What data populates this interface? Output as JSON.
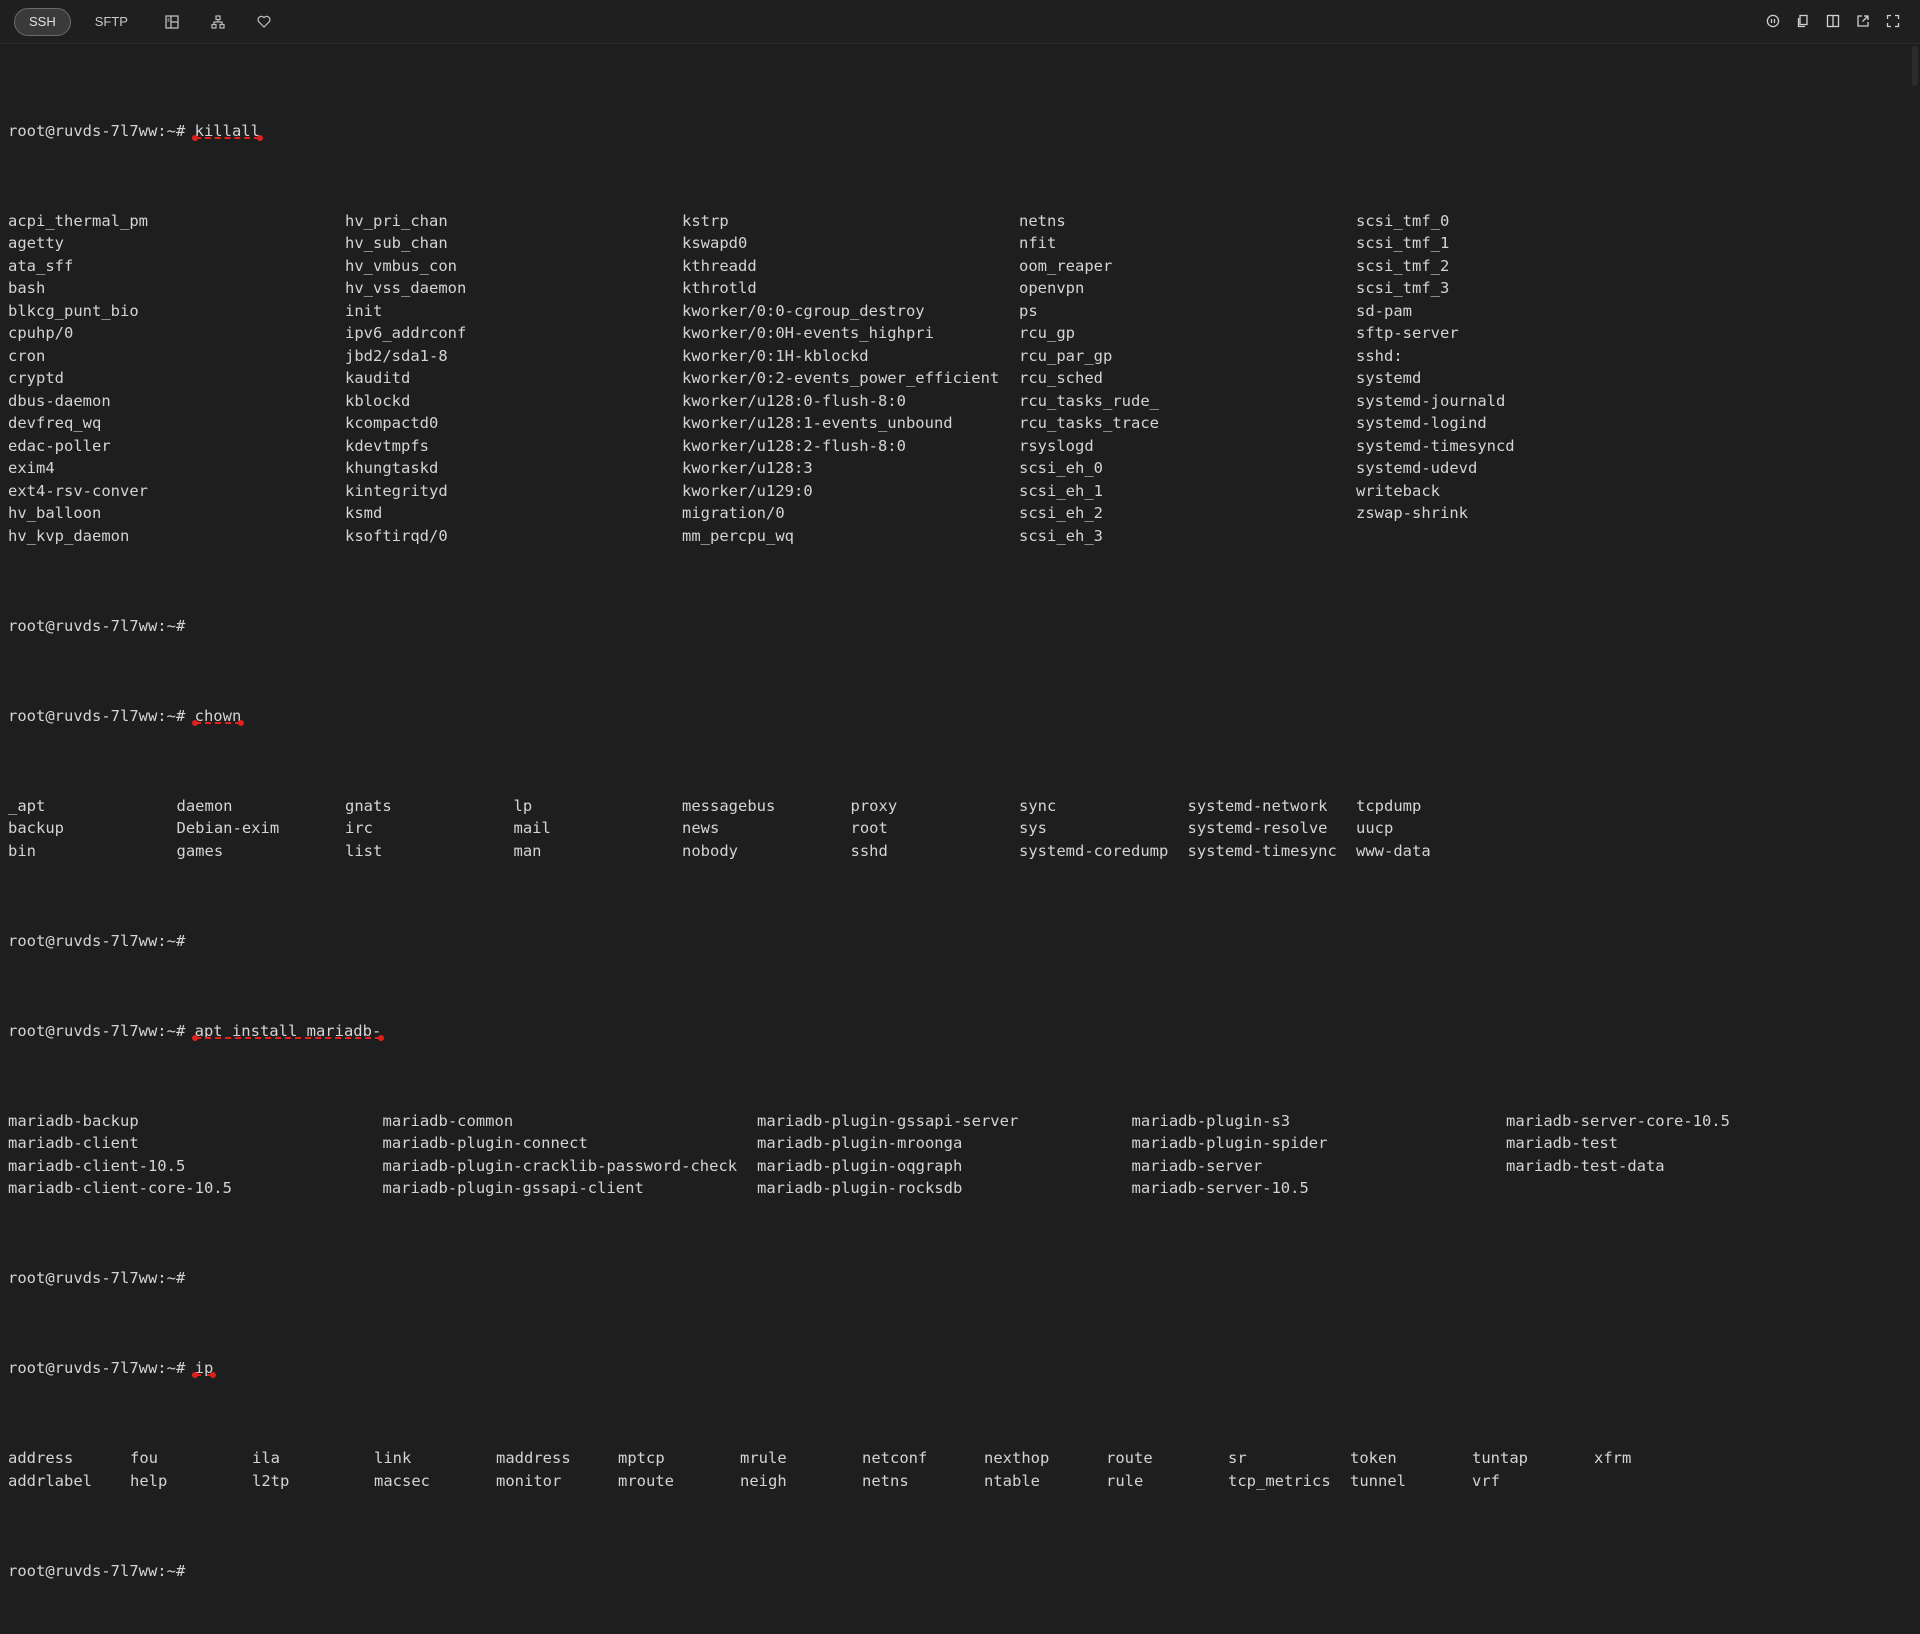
{
  "tabs": {
    "ssh": "SSH",
    "sftp": "SFTP"
  },
  "icons": {
    "toolbar": [
      "layout-icon",
      "network-tree-icon",
      "heart-icon"
    ],
    "right": [
      "info-circle-icon",
      "copy-icon",
      "columns-icon",
      "open-external-icon",
      "fullscreen-icon"
    ]
  },
  "colors": {
    "background": "#1e1e1e",
    "text": "#d4d4d4",
    "annotation": "#e0201c",
    "cursor": "#c9d07a"
  },
  "terminal": {
    "prompt": "root@ruvds-7l7ww:~# ",
    "cmd_killall": "killall",
    "killall_rows": [
      [
        "acpi_thermal_pm",
        "hv_pri_chan",
        "kstrp",
        "netns",
        "scsi_tmf_0"
      ],
      [
        "agetty",
        "hv_sub_chan",
        "kswapd0",
        "nfit",
        "scsi_tmf_1"
      ],
      [
        "ata_sff",
        "hv_vmbus_con",
        "kthreadd",
        "oom_reaper",
        "scsi_tmf_2"
      ],
      [
        "bash",
        "hv_vss_daemon",
        "kthrotld",
        "openvpn",
        "scsi_tmf_3"
      ],
      [
        "blkcg_punt_bio",
        "init",
        "kworker/0:0-cgroup_destroy",
        "ps",
        "sd-pam"
      ],
      [
        "cpuhp/0",
        "ipv6_addrconf",
        "kworker/0:0H-events_highpri",
        "rcu_gp",
        "sftp-server"
      ],
      [
        "cron",
        "jbd2/sda1-8",
        "kworker/0:1H-kblockd",
        "rcu_par_gp",
        "sshd:"
      ],
      [
        "cryptd",
        "kauditd",
        "kworker/0:2-events_power_efficient",
        "rcu_sched",
        "systemd"
      ],
      [
        "dbus-daemon",
        "kblockd",
        "kworker/u128:0-flush-8:0",
        "rcu_tasks_rude_",
        "systemd-journald"
      ],
      [
        "devfreq_wq",
        "kcompactd0",
        "kworker/u128:1-events_unbound",
        "rcu_tasks_trace",
        "systemd-logind"
      ],
      [
        "edac-poller",
        "kdevtmpfs",
        "kworker/u128:2-flush-8:0",
        "rsyslogd",
        "systemd-timesyncd"
      ],
      [
        "exim4",
        "khungtaskd",
        "kworker/u128:3",
        "scsi_eh_0",
        "systemd-udevd"
      ],
      [
        "ext4-rsv-conver",
        "kintegrityd",
        "kworker/u129:0",
        "scsi_eh_1",
        "writeback"
      ],
      [
        "hv_balloon",
        "ksmd",
        "migration/0",
        "scsi_eh_2",
        "zswap-shrink"
      ],
      [
        "hv_kvp_daemon",
        "ksoftirqd/0",
        "mm_percpu_wq",
        "scsi_eh_3",
        ""
      ]
    ],
    "cmd_chown": "chown",
    "chown_rows": [
      [
        "_apt",
        "daemon",
        "gnats",
        "lp",
        "messagebus",
        "proxy",
        "sync",
        "systemd-network",
        "tcpdump"
      ],
      [
        "backup",
        "Debian-exim",
        "irc",
        "mail",
        "news",
        "root",
        "sys",
        "systemd-resolve",
        "uucp"
      ],
      [
        "bin",
        "games",
        "list",
        "man",
        "nobody",
        "sshd",
        "systemd-coredump",
        "systemd-timesync",
        "www-data"
      ]
    ],
    "cmd_apt": "apt install mariadb-",
    "apt_rows": [
      [
        "mariadb-backup",
        "mariadb-common",
        "mariadb-plugin-gssapi-server",
        "mariadb-plugin-s3",
        "mariadb-server-core-10.5"
      ],
      [
        "mariadb-client",
        "mariadb-plugin-connect",
        "mariadb-plugin-mroonga",
        "mariadb-plugin-spider",
        "mariadb-test"
      ],
      [
        "mariadb-client-10.5",
        "mariadb-plugin-cracklib-password-check",
        "mariadb-plugin-oqgraph",
        "mariadb-server",
        "mariadb-test-data"
      ],
      [
        "mariadb-client-core-10.5",
        "mariadb-plugin-gssapi-client",
        "mariadb-plugin-rocksdb",
        "mariadb-server-10.5",
        ""
      ]
    ],
    "cmd_ip": "ip",
    "ip_rows": [
      [
        "address",
        "fou",
        "ila",
        "link",
        "maddress",
        "mptcp",
        "mrule",
        "netconf",
        "nexthop",
        "route",
        "sr",
        "token",
        "tuntap",
        "xfrm"
      ],
      [
        "addrlabel",
        "help",
        "l2tp",
        "macsec",
        "monitor",
        "mroute",
        "neigh",
        "netns",
        "ntable",
        "rule",
        "tcp_metrics",
        "tunnel",
        "vrf",
        ""
      ]
    ]
  }
}
